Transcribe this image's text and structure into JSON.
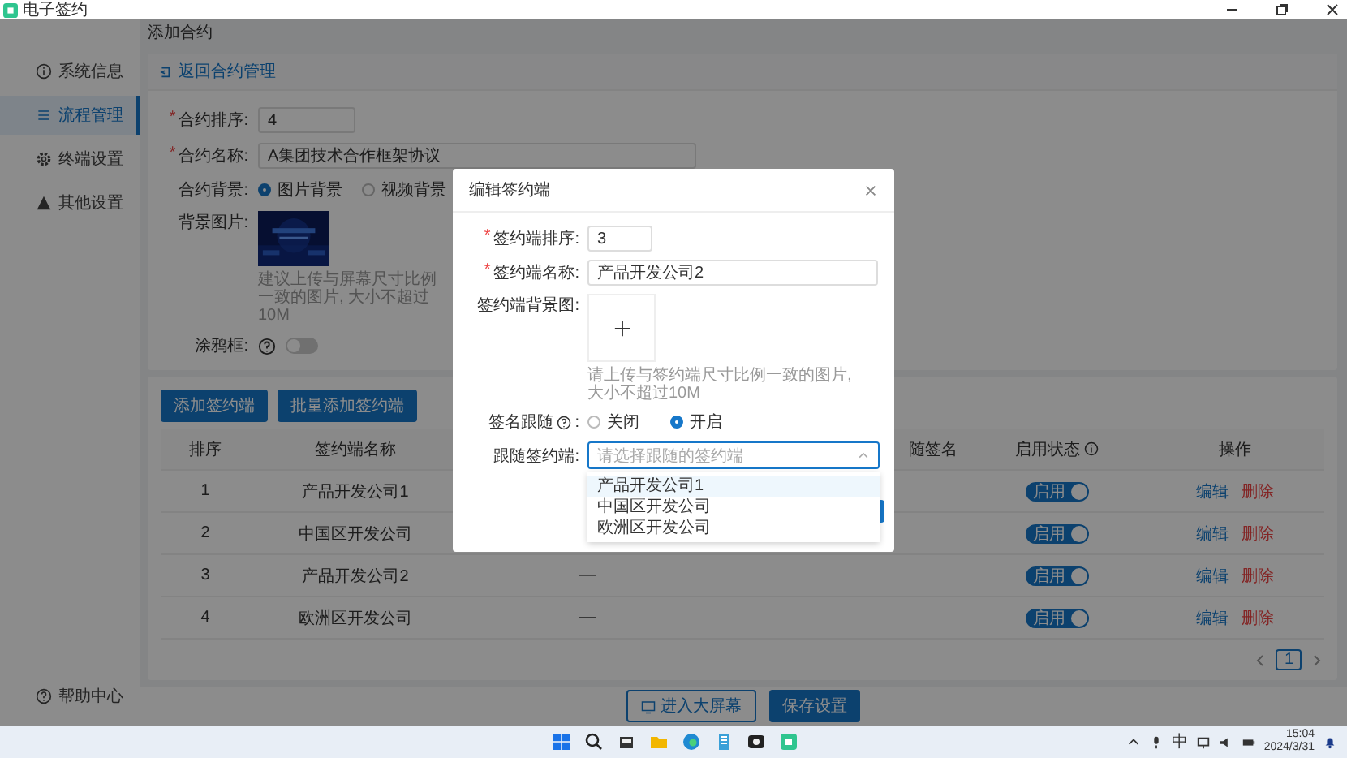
{
  "window": {
    "title": "电子签约"
  },
  "sidebar": {
    "items": [
      {
        "label": "系统信息",
        "selected": false
      },
      {
        "label": "流程管理",
        "selected": true
      },
      {
        "label": "终端设置",
        "selected": false
      },
      {
        "label": "其他设置",
        "selected": false
      }
    ],
    "footer": "帮助中心"
  },
  "breadcrumb": "添加合约",
  "back_link": "返回合约管理",
  "form": {
    "order": {
      "label": "合约排序:",
      "required_mark": "*",
      "value": "4"
    },
    "name": {
      "label": "合约名称:",
      "required_mark": "*",
      "value": "A集团技术合作框架协议"
    },
    "background": {
      "label": "合约背景:",
      "options": [
        {
          "label": "图片背景",
          "selected": true
        },
        {
          "label": "视频背景",
          "selected": false
        }
      ]
    },
    "image": {
      "label": "背景图片:",
      "hint": "建议上传与屏幕尺寸比例一致的图片, 大小不超过10M"
    },
    "doodle": {
      "label": "涂鸦框:",
      "on": false
    }
  },
  "table": {
    "buttons": [
      "添加签约端",
      "批量添加签约端"
    ],
    "columns": [
      {
        "label": "排序"
      },
      {
        "label": "签约端名称"
      },
      {},
      {
        "label": "随签名"
      },
      {
        "label": "启用状态",
        "help": true
      },
      {
        "label": "操作"
      }
    ],
    "rows": [
      {
        "order": "1",
        "name": "产品开发公司1",
        "enabled": true,
        "status_label": "启用",
        "actions": [
          "编辑",
          "删除"
        ]
      },
      {
        "order": "2",
        "name": "中国区开发公司",
        "enabled": true,
        "status_label": "启用",
        "actions": [
          "编辑",
          "删除"
        ]
      },
      {
        "order": "3",
        "name": "产品开发公司2",
        "column_3": "—",
        "enabled": true,
        "status_label": "启用",
        "actions": [
          "编辑",
          "删除"
        ]
      },
      {
        "order": "4",
        "name": "欧洲区开发公司",
        "column_3": "—",
        "enabled": true,
        "status_label": "启用",
        "actions": [
          "编辑",
          "删除"
        ]
      }
    ],
    "pages": [
      {
        "label": "1",
        "selected": true
      }
    ]
  },
  "footer_buttons": [
    {
      "label": "进入大屏幕",
      "kind": "outline"
    },
    {
      "label": "保存设置",
      "kind": "primary"
    }
  ],
  "dialog": {
    "title": "编辑签约端",
    "order": {
      "label": "签约端排序:",
      "required_mark": "*",
      "value": "3"
    },
    "name": {
      "label": "签约端名称:",
      "required_mark": "*",
      "value": "产品开发公司2"
    },
    "image": {
      "label": "签约端背景图:",
      "hint": "请上传与签约端尺寸比例一致的图片, 大小不超过10M"
    },
    "follow": {
      "label": "签名跟随",
      "label_suffix": ":",
      "options": [
        {
          "label": "关闭",
          "selected": false
        },
        {
          "label": "开启",
          "selected": true
        }
      ]
    },
    "target": {
      "label": "跟随签约端:",
      "placeholder": "请选择跟随的签约端",
      "expanded": true,
      "options": [
        {
          "label": "产品开发公司1",
          "highlighted": true
        },
        {
          "label": "中国区开发公司",
          "highlighted": false
        },
        {
          "label": "欧洲区开发公司",
          "highlighted": false
        }
      ]
    }
  },
  "taskbar": {
    "tray_input": "中",
    "time": "15:04",
    "date": "2024/3/31"
  }
}
